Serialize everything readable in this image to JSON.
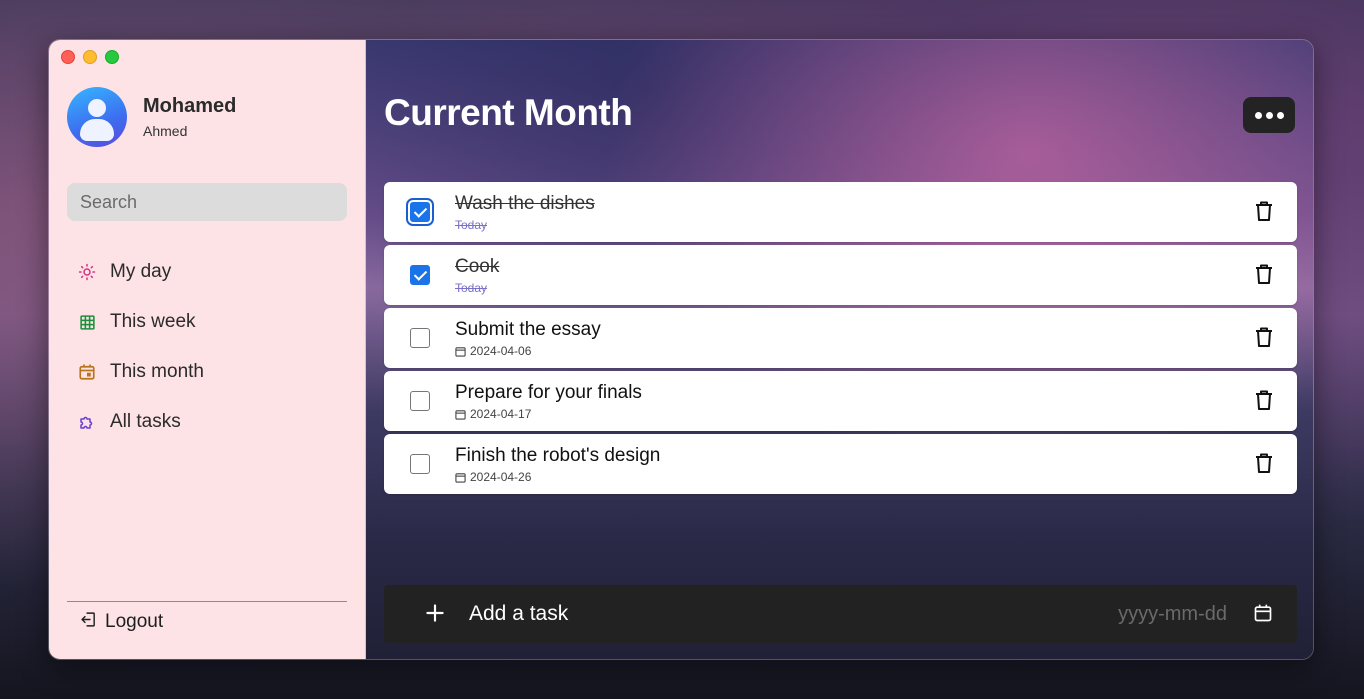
{
  "window": {
    "traffic_lights": [
      "close",
      "minimize",
      "zoom"
    ]
  },
  "profile": {
    "first_name": "Mohamed",
    "last_name": "Ahmed"
  },
  "search": {
    "placeholder": "Search"
  },
  "sidebar": {
    "items": [
      {
        "label": "My day",
        "icon": "sun-icon",
        "color": "#d63384"
      },
      {
        "label": "This week",
        "icon": "grid-calendar-icon",
        "color": "#1e8e3e"
      },
      {
        "label": "This month",
        "icon": "calendar-icon",
        "color": "#b8741a"
      },
      {
        "label": "All tasks",
        "icon": "puzzle-icon",
        "color": "#6a3fd0"
      }
    ],
    "logout_label": "Logout"
  },
  "main": {
    "title": "Current Month",
    "tasks": [
      {
        "title": "Wash the dishes",
        "subtitle": "Today",
        "checked": true
      },
      {
        "title": "Cook",
        "subtitle": "Today",
        "checked": true
      },
      {
        "title": "Submit the essay",
        "subtitle": "2024-04-06",
        "checked": false
      },
      {
        "title": "Prepare for your finals",
        "subtitle": "2024-04-17",
        "checked": false
      },
      {
        "title": "Finish the robot's design",
        "subtitle": "2024-04-26",
        "checked": false
      }
    ],
    "add_task": {
      "placeholder": "Add a task",
      "date_placeholder": "yyyy-mm-dd"
    }
  },
  "colors": {
    "sidebar_bg": "#fde3e5",
    "accent": "#1a73e8",
    "add_bar_bg": "#222222"
  }
}
